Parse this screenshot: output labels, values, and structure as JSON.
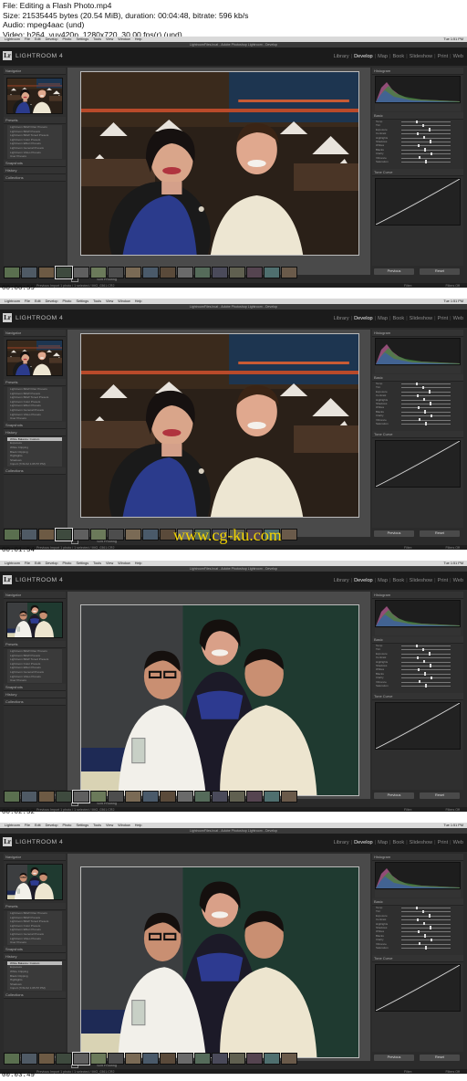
{
  "file_info": {
    "line1": "File: Editing a Flash Photo.mp4",
    "line2": "Size: 21535445 bytes (20.54 MiB), duration: 00:04:48, bitrate: 596 kb/s",
    "line3": "Audio: mpeg4aac (und)",
    "line4": "Video: h264, yuv420p, 1280x720, 30.00 fps(r) (und)"
  },
  "frames": [
    {
      "timestamp": "00:00:59",
      "photo": "couple",
      "left_mode": "presets",
      "right_mode": "basic"
    },
    {
      "timestamp": "00:01:54",
      "photo": "couple",
      "left_mode": "history",
      "right_mode": "basic"
    },
    {
      "timestamp": "00:02:52",
      "photo": "kids",
      "left_mode": "presets",
      "right_mode": "basic"
    },
    {
      "timestamp": "00:03:49",
      "photo": "kids",
      "left_mode": "history",
      "right_mode": "basic"
    }
  ],
  "watermark": "www.cg-ku.com",
  "app": {
    "name": "LIGHTROOM 4",
    "logo": "Lr",
    "window_title": "LightroomFiles.lrcat - Adobe Photoshop Lightroom - Develop",
    "mac_menu": [
      "Lightroom",
      "File",
      "Edit",
      "Develop",
      "Photo",
      "Settings",
      "Tools",
      "View",
      "Window",
      "Help"
    ],
    "mac_status": "Tue 1:51 PM",
    "modules": [
      "Library",
      "Develop",
      "Map",
      "Book",
      "Slideshow",
      "Print",
      "Web"
    ],
    "active_module": "Develop"
  },
  "left_panel": {
    "navigator": "Navigator",
    "presets": "Presets",
    "snapshots": "Snapshots",
    "history": "History",
    "collections": "Collections",
    "copy": "Copy...",
    "paste": "Paste",
    "preset_items": [
      "Lightroom B&W Filter Presets",
      "Lightroom B&W Presets",
      "Lightroom B&W Toned Presets",
      "Lightroom Color Presets",
      "Lightroom Effect Presets",
      "Lightroom General Presets",
      "Lightroom Video Presets",
      "User Presets"
    ],
    "history_items": [
      "White Balance: Custom",
      "Exposure",
      "White Clipping",
      "Black Clipping",
      "Highlights",
      "Shadows",
      "Import (7/31/12 1:05:57 PM)"
    ]
  },
  "right_panel": {
    "histogram": "Histogram",
    "basic": "Basic",
    "tone_curve": "Tone Curve",
    "previous": "Previous",
    "reset": "Reset",
    "sliders": [
      "Temp",
      "Tint",
      "Exposure",
      "Contrast",
      "Highlights",
      "Shadows",
      "Whites",
      "Blacks",
      "Clarity",
      "Vibrance",
      "Saturation"
    ]
  },
  "toolbar": {
    "soft_proofing": "Soft Proofing",
    "filmstrip_path": "Previous Import  1 photo / 1 selected / IMG_0361.CR2",
    "filter": "Filter:",
    "filter_value": "Filters Off"
  }
}
